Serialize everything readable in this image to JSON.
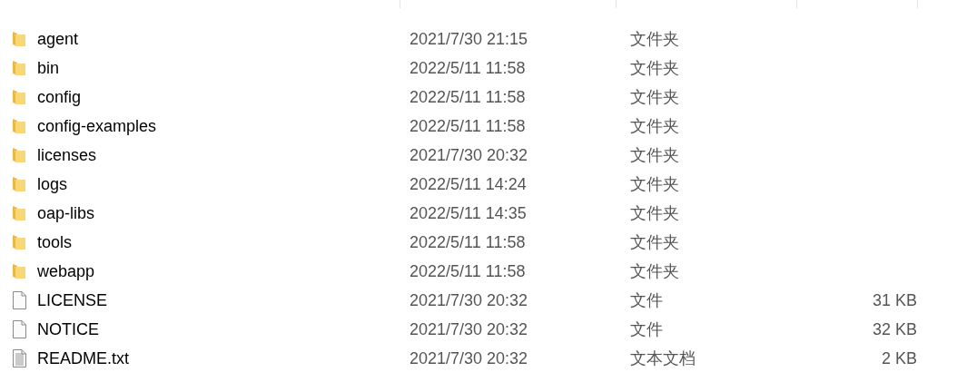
{
  "files": [
    {
      "kind": "folder",
      "name": "agent",
      "modified": "2021/7/30 21:15",
      "type": "文件夹"
    },
    {
      "kind": "folder",
      "name": "bin",
      "modified": "2022/5/11 11:58",
      "type": "文件夹"
    },
    {
      "kind": "folder",
      "name": "config",
      "modified": "2022/5/11 11:58",
      "type": "文件夹"
    },
    {
      "kind": "folder",
      "name": "config-examples",
      "modified": "2022/5/11 11:58",
      "type": "文件夹"
    },
    {
      "kind": "folder",
      "name": "licenses",
      "modified": "2021/7/30 20:32",
      "type": "文件夹"
    },
    {
      "kind": "folder",
      "name": "logs",
      "modified": "2022/5/11 14:24",
      "type": "文件夹"
    },
    {
      "kind": "folder",
      "name": "oap-libs",
      "modified": "2022/5/11 14:35",
      "type": "文件夹"
    },
    {
      "kind": "folder",
      "name": "tools",
      "modified": "2022/5/11 11:58",
      "type": "文件夹"
    },
    {
      "kind": "folder",
      "name": "webapp",
      "modified": "2022/5/11 11:58",
      "type": "文件夹"
    },
    {
      "kind": "file",
      "name": "LICENSE",
      "modified": "2021/7/30 20:32",
      "type": "文件",
      "size": "31 KB"
    },
    {
      "kind": "file",
      "name": "NOTICE",
      "modified": "2021/7/30 20:32",
      "type": "文件",
      "size": "32 KB"
    },
    {
      "kind": "text",
      "name": "README.txt",
      "modified": "2021/7/30 20:32",
      "type": "文本文档",
      "size": "2 KB"
    }
  ]
}
